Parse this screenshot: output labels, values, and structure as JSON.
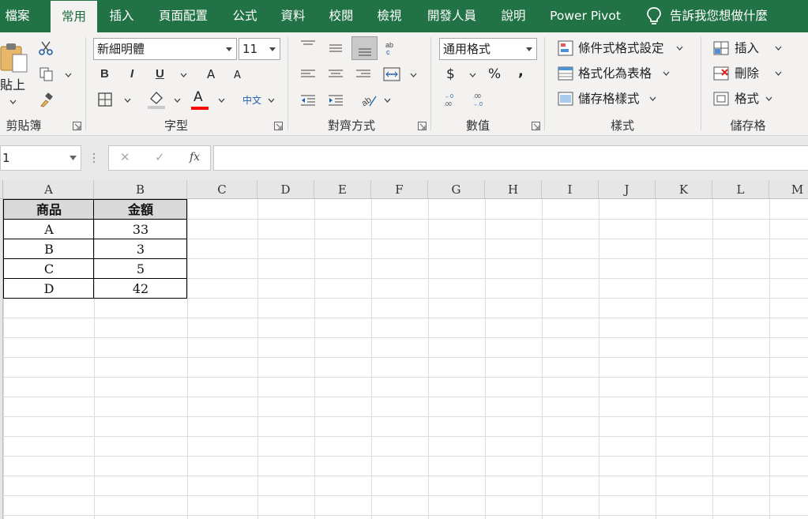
{
  "tabs": [
    "檔案",
    "常用",
    "插入",
    "頁面配置",
    "公式",
    "資料",
    "校閱",
    "檢視",
    "開發人員",
    "說明",
    "Power Pivot"
  ],
  "tell_me": "告訴我您想做什麼",
  "ribbon": {
    "clipboard": {
      "paste_label": "貼上",
      "group_label": "剪貼簿"
    },
    "font": {
      "font_name": "新細明體",
      "font_size": "11",
      "bold": "B",
      "italic": "I",
      "underline": "U",
      "grow": "A",
      "shrink": "A",
      "font_color": "A",
      "phonetic": "中文",
      "group_label": "字型"
    },
    "alignment": {
      "group_label": "對齊方式"
    },
    "number": {
      "format": "通用格式",
      "currency": "$",
      "percent": "%",
      "comma": ",",
      "group_label": "數值"
    },
    "styles": {
      "conditional": "條件式格式設定",
      "as_table": "格式化為表格",
      "cell_styles": "儲存格樣式",
      "group_label": "樣式"
    },
    "cells": {
      "insert": "插入",
      "delete": "刪除",
      "format": "格式",
      "group_label": "儲存格"
    }
  },
  "formula_bar": {
    "name_box": "1",
    "cancel": "✕",
    "enter": "✓",
    "fx": "fx",
    "value": ""
  },
  "columns": [
    "A",
    "B",
    "C",
    "D",
    "E",
    "F",
    "G",
    "H",
    "I",
    "J",
    "K",
    "L",
    "M"
  ],
  "table": {
    "headers": [
      "商品",
      "金額"
    ],
    "rows": [
      [
        "A",
        "33"
      ],
      [
        "B",
        "3"
      ],
      [
        "C",
        "5"
      ],
      [
        "D",
        "42"
      ]
    ]
  },
  "colors": {
    "brand": "#217346",
    "font_color_bar": "#ff0000",
    "header_fill": "#d9d9d9"
  }
}
